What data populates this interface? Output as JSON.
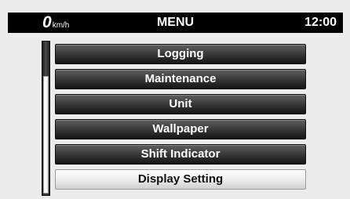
{
  "header": {
    "speed_value": "0",
    "speed_unit": "km/h",
    "title": "MENU",
    "time": "12:00"
  },
  "menu": {
    "items": [
      {
        "label": "Logging",
        "selected": false
      },
      {
        "label": "Maintenance",
        "selected": false
      },
      {
        "label": "Unit",
        "selected": false
      },
      {
        "label": "Wallpaper",
        "selected": false
      },
      {
        "label": "Shift Indicator",
        "selected": false
      },
      {
        "label": "Display Setting",
        "selected": true
      }
    ]
  },
  "colors": {
    "header_bg": "#000000",
    "button_dark": "#3c3c3c",
    "button_selected": "#f0f0f0",
    "background": "#ececec"
  }
}
